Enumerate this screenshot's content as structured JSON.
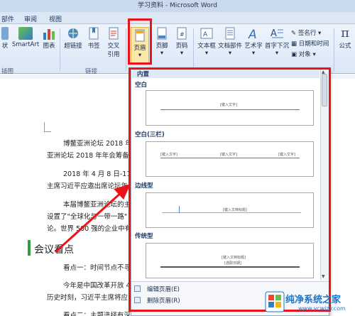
{
  "window": {
    "title": "学习资料 - Microsoft Word"
  },
  "ribbon": {
    "tabs": [
      "部件",
      "审阅",
      "视图"
    ],
    "buttons": {
      "shape": "状",
      "smartart": "SmartArt",
      "chart": "图表",
      "hyperlink": "超链接",
      "bookmark": "书签",
      "crossref_line1": "交叉",
      "crossref_line2": "引用",
      "header": "页眉",
      "footer": "页脚",
      "pagenum": "页码",
      "textbox": "文本框",
      "quickparts": "文档部件",
      "wordart": "艺术字",
      "dropcap": "首字下沉",
      "signature": "签名行",
      "datetime": "日期和时间",
      "object": "对象",
      "equation": "公式"
    },
    "group_labels": {
      "illustrations": "插图",
      "links": "链接"
    }
  },
  "gallery": {
    "heading": "内置",
    "sections": [
      {
        "title": "空白",
        "sample": [
          "[键入文字]"
        ]
      },
      {
        "title": "空白(三栏)",
        "sample": [
          "[键入文字]",
          "[键入文字]",
          "[键入文字]"
        ]
      },
      {
        "title": "边线型",
        "sample": [
          "[键入文档标题]"
        ]
      },
      {
        "title": "传统型",
        "sample": [
          "[键入文档标题]",
          "[选取日期]"
        ]
      }
    ],
    "menu": [
      {
        "label": "编辑页眉(E)"
      },
      {
        "label": "删除页眉(R)"
      }
    ]
  },
  "document": {
    "paragraphs": [
      "博鳌亚洲论坛 2018 年",
      "亚洲论坛 2018 年年会筹备",
      "2018 年 4 月 8 日-11",
      "主席习近平应邀出席论坛年",
      "本届博鳌亚洲论坛的主",
      "设置了\"全球化与一带一路\"",
      "论。世界 500 强的企业中有"
    ],
    "heading": "会议看点",
    "paragraphs2": [
      "看点一：时间节点不寻",
      "今年是中国改革开放 4",
      "历史时刻，习近平主席将应",
      "看点二：主题选择有深"
    ]
  },
  "watermark": {
    "name": "纯净系统之家",
    "url": "www.ycwjzy.com"
  },
  "colors": {
    "highlight": "#e8141a",
    "heading_bar": "#2f9e44",
    "watermark": "#1d73c9"
  }
}
